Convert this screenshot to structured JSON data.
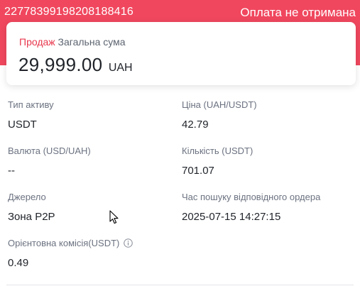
{
  "header": {
    "order_id": "22778399198208188416",
    "status": "Оплата не отримана",
    "accent_color": "#f0475e"
  },
  "summary": {
    "side_label": "Продаж",
    "total_label": "Загальна сума",
    "amount": "29,999.00",
    "currency": "UAH"
  },
  "details": {
    "asset_type": {
      "label": "Тип активу",
      "value": "USDT"
    },
    "price": {
      "label": "Ціна (UAH/USDT)",
      "value": "42.79"
    },
    "currency": {
      "label": "Валюта (USD/UAH)",
      "value": "--"
    },
    "quantity": {
      "label": "Кількість (USDT)",
      "value": "701.07"
    },
    "source": {
      "label": "Джерело",
      "value": "Зона P2P"
    },
    "matching_order_time": {
      "label": "Час пошуку відповідного ордера",
      "value": "2025-07-15 14:27:15"
    },
    "estimated_fee": {
      "label": "Орієнтовна комісія(USDT)",
      "value": "0.49",
      "icon": "info-icon"
    }
  }
}
